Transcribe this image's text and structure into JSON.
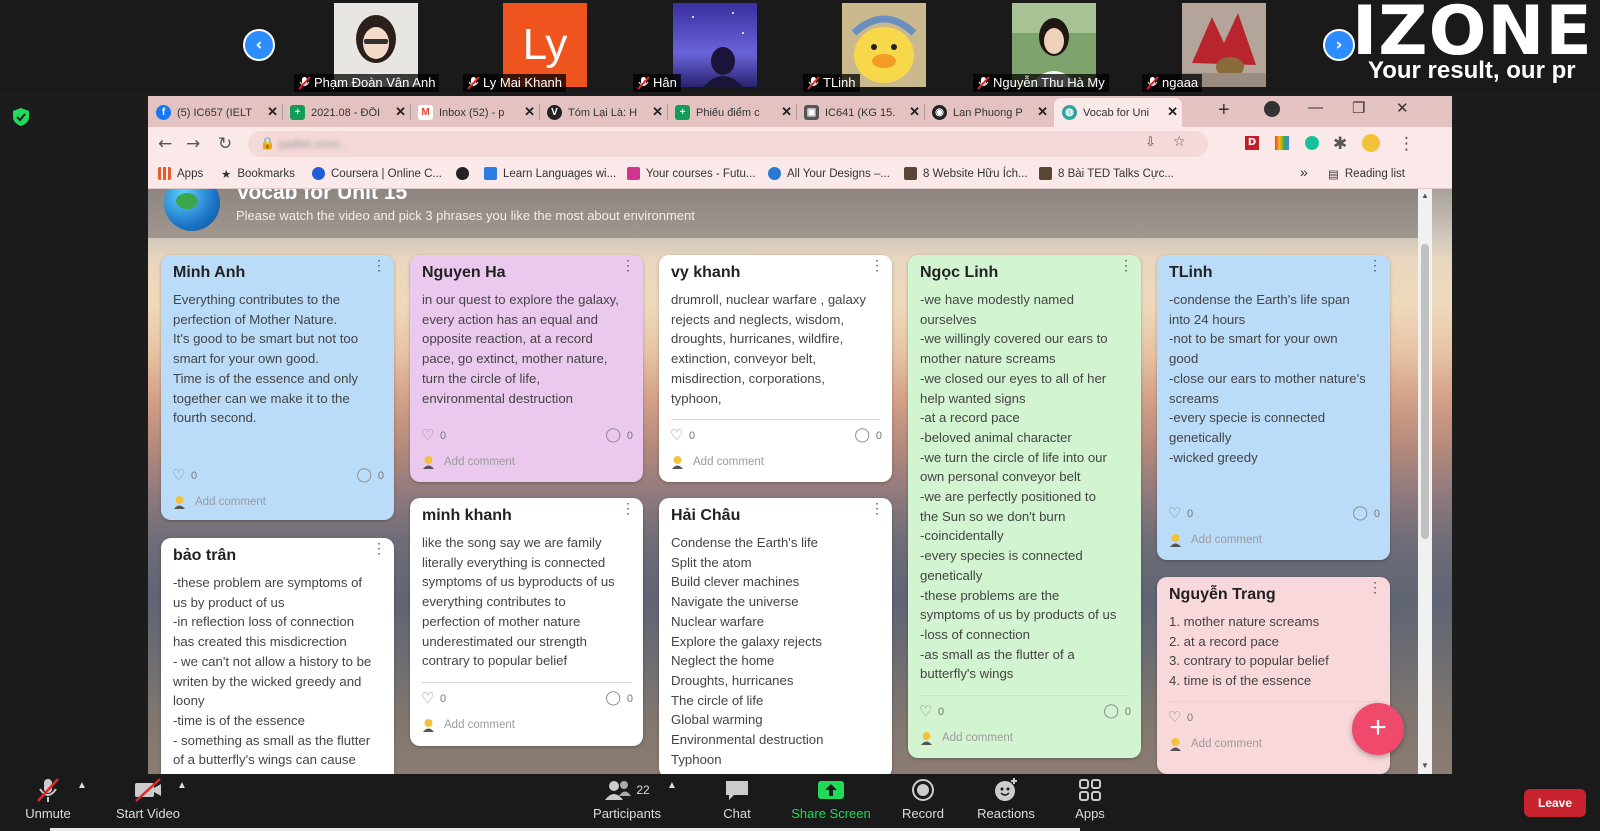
{
  "meeting": {
    "participants": [
      {
        "name": "Phạm Đoàn Vân Anh"
      },
      {
        "name": "Ly Mai Khanh",
        "initials": "Ly"
      },
      {
        "name": "Hân"
      },
      {
        "name": "TLinh"
      },
      {
        "name": "Nguyễn Thu Hà My"
      },
      {
        "name": "ngaaa"
      }
    ],
    "share_title": "IZONE",
    "share_subtitle": "Your result, our pr"
  },
  "browser": {
    "tabs": [
      {
        "label": "(5) IC657 (IELT",
        "icon": "facebook-icon",
        "color": "#1877f2",
        "glyph": "f"
      },
      {
        "label": "2021.08 - ĐỐI",
        "icon": "sheets-icon",
        "color": "#0f9d58",
        "glyph": "+"
      },
      {
        "label": "Inbox (52) - p",
        "icon": "gmail-icon",
        "color": "#ea4335",
        "glyph": "M"
      },
      {
        "label": "Tóm Lại Là: H",
        "icon": "v-icon",
        "color": "#222222",
        "glyph": "V"
      },
      {
        "label": "Phiếu điểm c",
        "icon": "sheets-icon",
        "color": "#0f9d58",
        "glyph": "+"
      },
      {
        "label": "IC641 (KG 15.",
        "icon": "classroom-icon",
        "color": "#555555",
        "glyph": "▣"
      },
      {
        "label": "Lan Phuong P",
        "icon": "messenger-icon",
        "color": "#222222",
        "glyph": "◉"
      },
      {
        "label": "Vocab for Uni",
        "icon": "padlet-icon",
        "color": "#2aa6a0",
        "glyph": "◍"
      }
    ],
    "url": "padlet.com/...",
    "bookmarks": [
      {
        "label": "Apps",
        "icon": "apps-grid-icon",
        "color": "#e35d2c"
      },
      {
        "label": "Bookmarks",
        "icon": "star-icon",
        "color": "#333333"
      },
      {
        "label": "Coursera | Online C...",
        "icon": "coursera-icon",
        "color": "#1f5cd6"
      },
      {
        "label": "",
        "icon": "github-icon",
        "color": "#222222"
      },
      {
        "label": "Learn Languages wi...",
        "icon": "learn-languages-icon",
        "color": "#2d7be5"
      },
      {
        "label": "Your courses - Futu...",
        "icon": "futurelearn-icon",
        "color": "#d3348d"
      },
      {
        "label": "All Your Designs –...",
        "icon": "canva-icon",
        "color": "#2a7ad3"
      },
      {
        "label": "8 Website Hữu Ích...",
        "icon": "box-icon",
        "color": "#5a4636"
      },
      {
        "label": "8 Bài TED Talks Cực...",
        "icon": "box-icon",
        "color": "#5a4636"
      }
    ],
    "bookmarks_more": "»",
    "reading_list": "Reading list"
  },
  "padlet": {
    "title": "Vocab for Unit 15",
    "description": "Please watch the video and pick 3 phrases you like the most about environment",
    "add_comment": "Add comment",
    "cards": [
      {
        "author": "Minh Anh",
        "lines": [
          "Everything contributes to the",
          "perfection of Mother Nature.",
          "It's good to be smart but  not too",
          "smart for your own good.",
          "Time is of the essence and only",
          "together can we make it to the",
          "fourth second."
        ],
        "likes": "0",
        "comments": "0"
      },
      {
        "author": "bảo trân",
        "lines": [
          "-these problem are symptoms of",
          "us by product of us",
          "-in reflection loss of connection",
          "has created this misdicrection",
          "- we can't not allow a history to be",
          "writen by the wicked greedy and",
          "loony",
          "-time is of the essence",
          "- something as small as the flutter",
          "of a butterfly's wings can cause"
        ]
      },
      {
        "author": "Nguyen Ha",
        "lines": [
          "in our quest to explore the galaxy,",
          "every action has an equal and",
          "opposite reaction, at a record",
          "pace, go extinct, mother nature,",
          "turn the circle of life,",
          "environmental destruction"
        ],
        "likes": "0",
        "comments": "0"
      },
      {
        "author": "minh khanh",
        "lines": [
          "like the song say we are family",
          "literally everything is connected",
          "symptoms of us byproducts of us",
          "everything contributes to",
          "perfection of mother nature",
          "underestimated our strength",
          "contrary to popular belief"
        ],
        "likes": "0",
        "comments": "0"
      },
      {
        "author": "vy khanh",
        "lines": [
          "drumroll, nuclear warfare , galaxy",
          "rejects and neglects, wisdom,",
          "droughts, hurricanes, wildfire,",
          "extinction, conveyor belt,",
          "misdirection, corporations,",
          "typhoon,"
        ],
        "likes": "0",
        "comments": "0"
      },
      {
        "author": "Hải Châu",
        "lines": [
          "Condense the Earth's life",
          "Split the atom",
          "Build clever machines",
          "Navigate the universe",
          "Nuclear warfare",
          "Explore the galaxy rejects",
          "Neglect the home",
          "Droughts, hurricanes",
          "The circle of life",
          "Global warming",
          "Environmental destruction",
          "Typhoon"
        ]
      },
      {
        "author": "Ngọc Linh",
        "lines": [
          "-we have modestly named",
          "ourselves",
          "-we willingly covered our ears to",
          "mother nature screams",
          "-we closed our eyes to all of her",
          "help wanted signs",
          "-at a record pace",
          "-beloved animal character",
          "-we turn the circle of life into our",
          "own personal conveyor belt",
          "-we are perfectly positioned to",
          "the Sun so we don't burn",
          "-coincidentally",
          "-every species is connected",
          "genetically",
          "-these problems are the",
          "symptoms of us by products of us",
          "-loss of connection",
          "-as small as the flutter of a",
          "butterfly's wings"
        ],
        "likes": "0",
        "comments": "0"
      },
      {
        "author": "TLinh",
        "lines": [
          "-condense the Earth's life span",
          "into 24 hours",
          "-not to be smart for your own",
          "good",
          "-close our ears to mother nature's",
          "screams",
          "-every specie is connected",
          "genetically",
          "-wicked greedy"
        ],
        "likes": "0",
        "comments": "0"
      },
      {
        "author": "Nguyễn Trang",
        "lines": [
          "1. mother nature screams",
          "2. at a record pace",
          "3. contrary to popular belief",
          "4. time is of the essence"
        ],
        "likes": "0"
      }
    ],
    "fab_label": "+"
  },
  "controls": {
    "unmute": "Unmute",
    "start_video": "Start Video",
    "participants_count": "22",
    "participants": "Participants",
    "chat": "Chat",
    "share_screen": "Share Screen",
    "record": "Record",
    "reactions": "Reactions",
    "apps": "Apps",
    "leave": "Leave"
  },
  "colors": {
    "zoom_blue": "#2d8cff",
    "share_green": "#23d959",
    "leave_red": "#c8232c",
    "padlet_fab": "#ef4a6c"
  }
}
